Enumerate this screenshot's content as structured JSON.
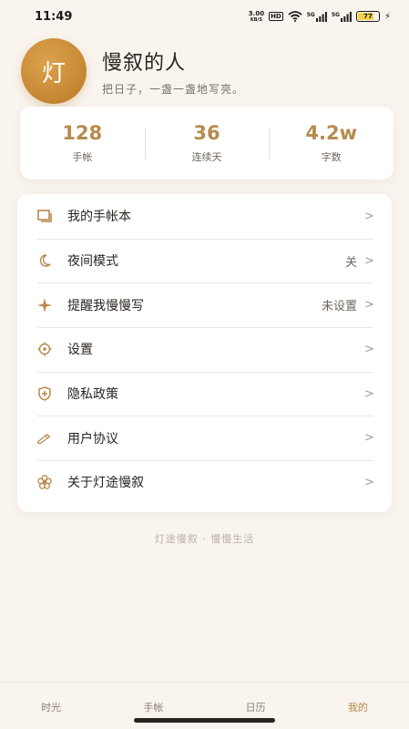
{
  "status_bar": {
    "time": "11:49",
    "net_speed_value": "3.00",
    "net_speed_unit": "KB/S",
    "hd_badge": "HD",
    "signal_1_label": "5G",
    "signal_2_label": "5G",
    "battery_percent": "77",
    "battery_level": 0.77,
    "charging_icon": "bolt-icon"
  },
  "profile": {
    "avatar_char": "灯",
    "name": "慢叙的人",
    "motto": "把日子，一盏一盏地写亮。"
  },
  "stats": [
    {
      "value": "128",
      "label": "手帐"
    },
    {
      "value": "36",
      "label": "连续天"
    },
    {
      "value": "4.2w",
      "label": "字数"
    }
  ],
  "menu": [
    {
      "icon": "notebook-icon",
      "label": "我的手帐本",
      "value": ""
    },
    {
      "icon": "moon-icon",
      "label": "夜间模式",
      "value": "关"
    },
    {
      "icon": "sparkle-icon",
      "label": "提醒我慢慢写",
      "value": "未设置"
    },
    {
      "icon": "gear-icon",
      "label": "设置",
      "value": ""
    },
    {
      "icon": "shield-icon",
      "label": "隐私政策",
      "value": ""
    },
    {
      "icon": "pencil-icon",
      "label": "用户协议",
      "value": ""
    },
    {
      "icon": "flower-icon",
      "label": "关于灯途慢叙",
      "value": ""
    }
  ],
  "chevron": ">",
  "footer": "灯途慢叙 · 慢慢生活",
  "bottom_nav": [
    {
      "label": "时光",
      "active": false
    },
    {
      "label": "手帐",
      "active": false
    },
    {
      "label": "日历",
      "active": false
    },
    {
      "label": "我的",
      "active": true
    }
  ],
  "colors": {
    "accent": "#b78a4e",
    "background": "#f9f4ee",
    "card": "#ffffff",
    "avatar": "#c98a36"
  }
}
